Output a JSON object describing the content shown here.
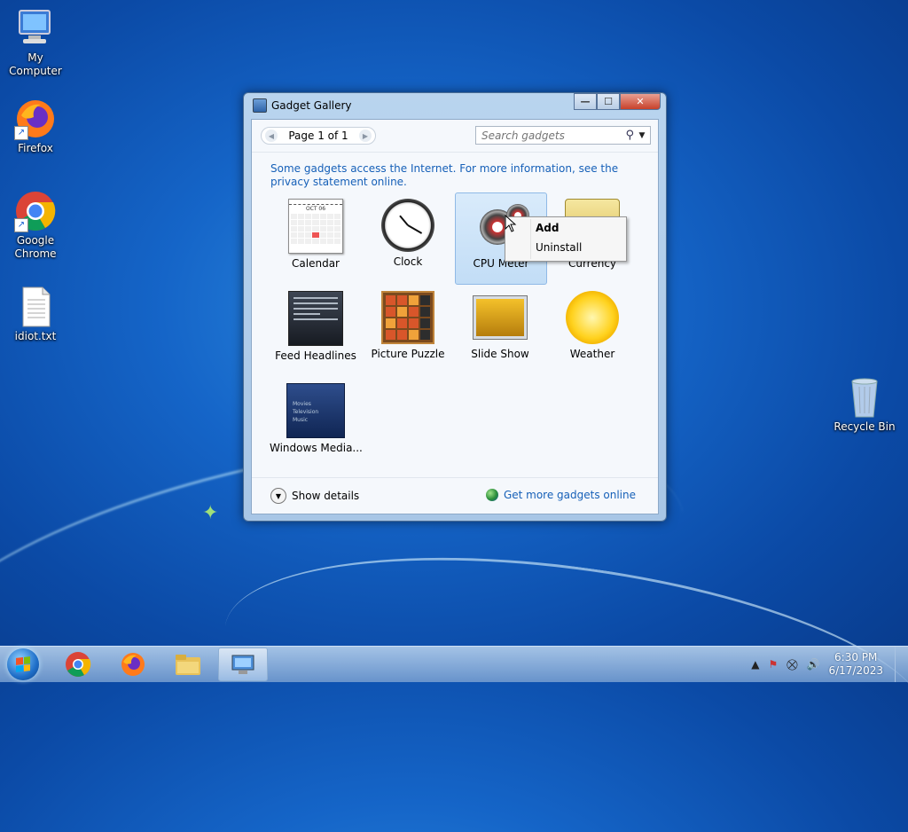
{
  "desktop": {
    "icons": [
      {
        "label": "My Computer"
      },
      {
        "label": "Firefox"
      },
      {
        "label": "Google Chrome"
      },
      {
        "label": "idiot.txt"
      },
      {
        "label": "Recycle Bin"
      }
    ]
  },
  "window": {
    "title": "Gadget Gallery",
    "controls": {
      "minimize": "—",
      "maximize": "☐",
      "close": "✕"
    },
    "pager": {
      "prev": "◀",
      "label": "Page 1 of 1",
      "next": "▶"
    },
    "search": {
      "placeholder": "Search gadgets",
      "search_icon": "⚲",
      "dropdown_icon": "▼"
    },
    "info_text": "Some gadgets access the Internet.  For more information, see the privacy statement online.",
    "gadgets": [
      {
        "label": "Calendar"
      },
      {
        "label": "Clock"
      },
      {
        "label": "CPU Meter"
      },
      {
        "label": "Currency"
      },
      {
        "label": "Feed Headlines"
      },
      {
        "label": "Picture Puzzle"
      },
      {
        "label": "Slide Show"
      },
      {
        "label": "Weather"
      },
      {
        "label": "Windows Media..."
      }
    ],
    "calendar_month": "OCT 06",
    "wmc_items": [
      "Movies",
      "Television",
      "Music"
    ],
    "footer": {
      "details_icon": "▼",
      "show_details": "Show details",
      "get_more": "Get more gadgets online"
    }
  },
  "context_menu": {
    "items": [
      {
        "label": "Add"
      },
      {
        "label": "Uninstall"
      }
    ]
  },
  "taskbar": {
    "tray": {
      "arrow": "▲",
      "network": "⛒",
      "volume": "🔊"
    },
    "time": "6:30 PM",
    "date": "6/17/2023"
  },
  "colors": {
    "link": "#1660b8",
    "accent": "#1f6fc9",
    "desktop": "#1565c8"
  }
}
